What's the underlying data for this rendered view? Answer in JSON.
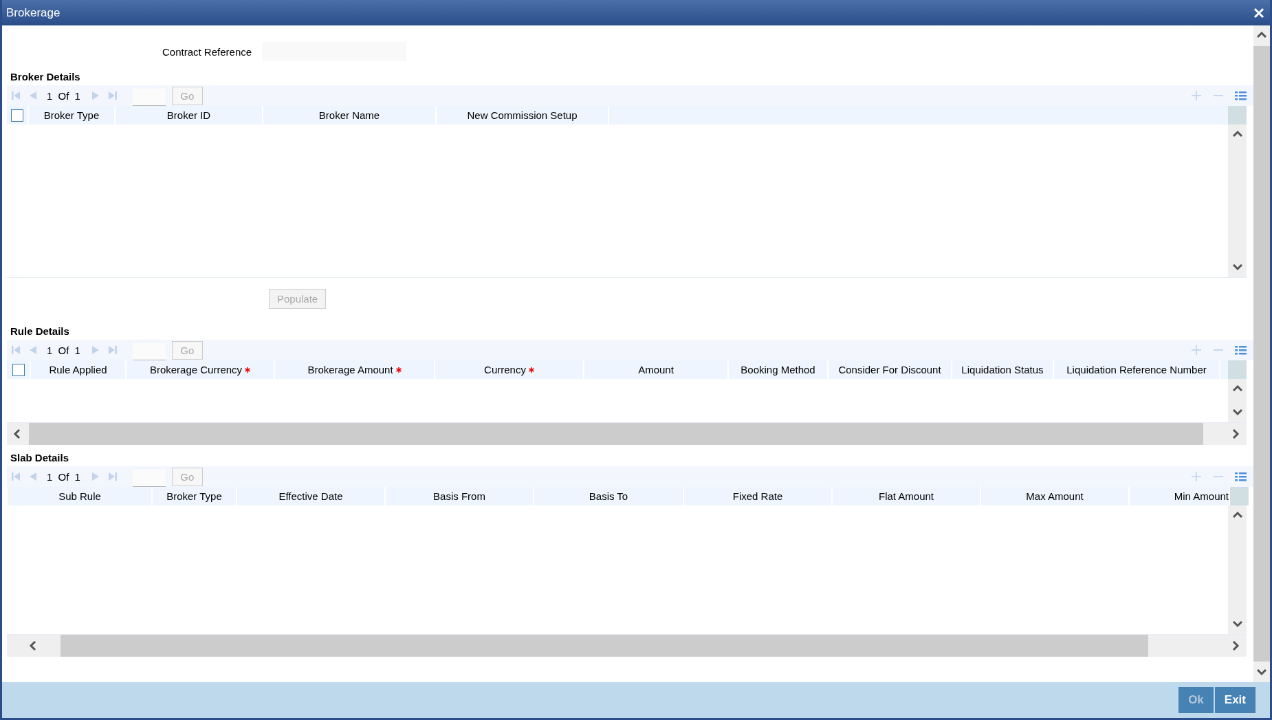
{
  "window": {
    "title": "Brokerage"
  },
  "contract_reference": {
    "label": "Contract Reference"
  },
  "sections": [
    {
      "title": "Broker Details",
      "pager": "1 Of 1",
      "go_button": {
        "label": "Go",
        "disabled": true
      },
      "select_all": {
        "checked": false
      },
      "columns": [
        {
          "label": "Broker Type",
          "required": false
        },
        {
          "label": "Broker ID",
          "required": false
        },
        {
          "label": "Broker Name",
          "required": false
        },
        {
          "label": "New Commission Setup",
          "required": false
        }
      ],
      "action_button": {
        "label": "Populate",
        "disabled": true
      }
    },
    {
      "title": "Rule Details",
      "pager": "1 Of 1",
      "go_button": {
        "label": "Go",
        "disabled": true
      },
      "select_all": {
        "checked": false
      },
      "columns": [
        {
          "label": "Rule Applied",
          "required": false
        },
        {
          "label": "Brokerage Currency",
          "required": true
        },
        {
          "label": "Brokerage Amount",
          "required": true
        },
        {
          "label": "Currency",
          "required": true
        },
        {
          "label": "Amount",
          "required": false
        },
        {
          "label": "Booking Method",
          "required": false
        },
        {
          "label": "Consider For Discount",
          "required": false
        },
        {
          "label": "Liquidation Status",
          "required": false
        },
        {
          "label": "Liquidation Reference Number",
          "required": false
        }
      ]
    },
    {
      "title": "Slab Details",
      "pager": "1 Of 1",
      "go_button": {
        "label": "Go",
        "disabled": true
      },
      "columns": [
        {
          "label": "Sub Rule",
          "required": false
        },
        {
          "label": "Broker Type",
          "required": false
        },
        {
          "label": "Effective Date",
          "required": false
        },
        {
          "label": "Basis From",
          "required": false
        },
        {
          "label": "Basis To",
          "required": false
        },
        {
          "label": "Fixed Rate",
          "required": false
        },
        {
          "label": "Flat Amount",
          "required": false
        },
        {
          "label": "Max Amount",
          "required": false
        },
        {
          "label": "Min Amount",
          "required": false
        }
      ]
    }
  ],
  "footer": {
    "buttons": [
      {
        "label": "Ok",
        "disabled": true
      },
      {
        "label": "Exit",
        "disabled": false
      }
    ]
  }
}
